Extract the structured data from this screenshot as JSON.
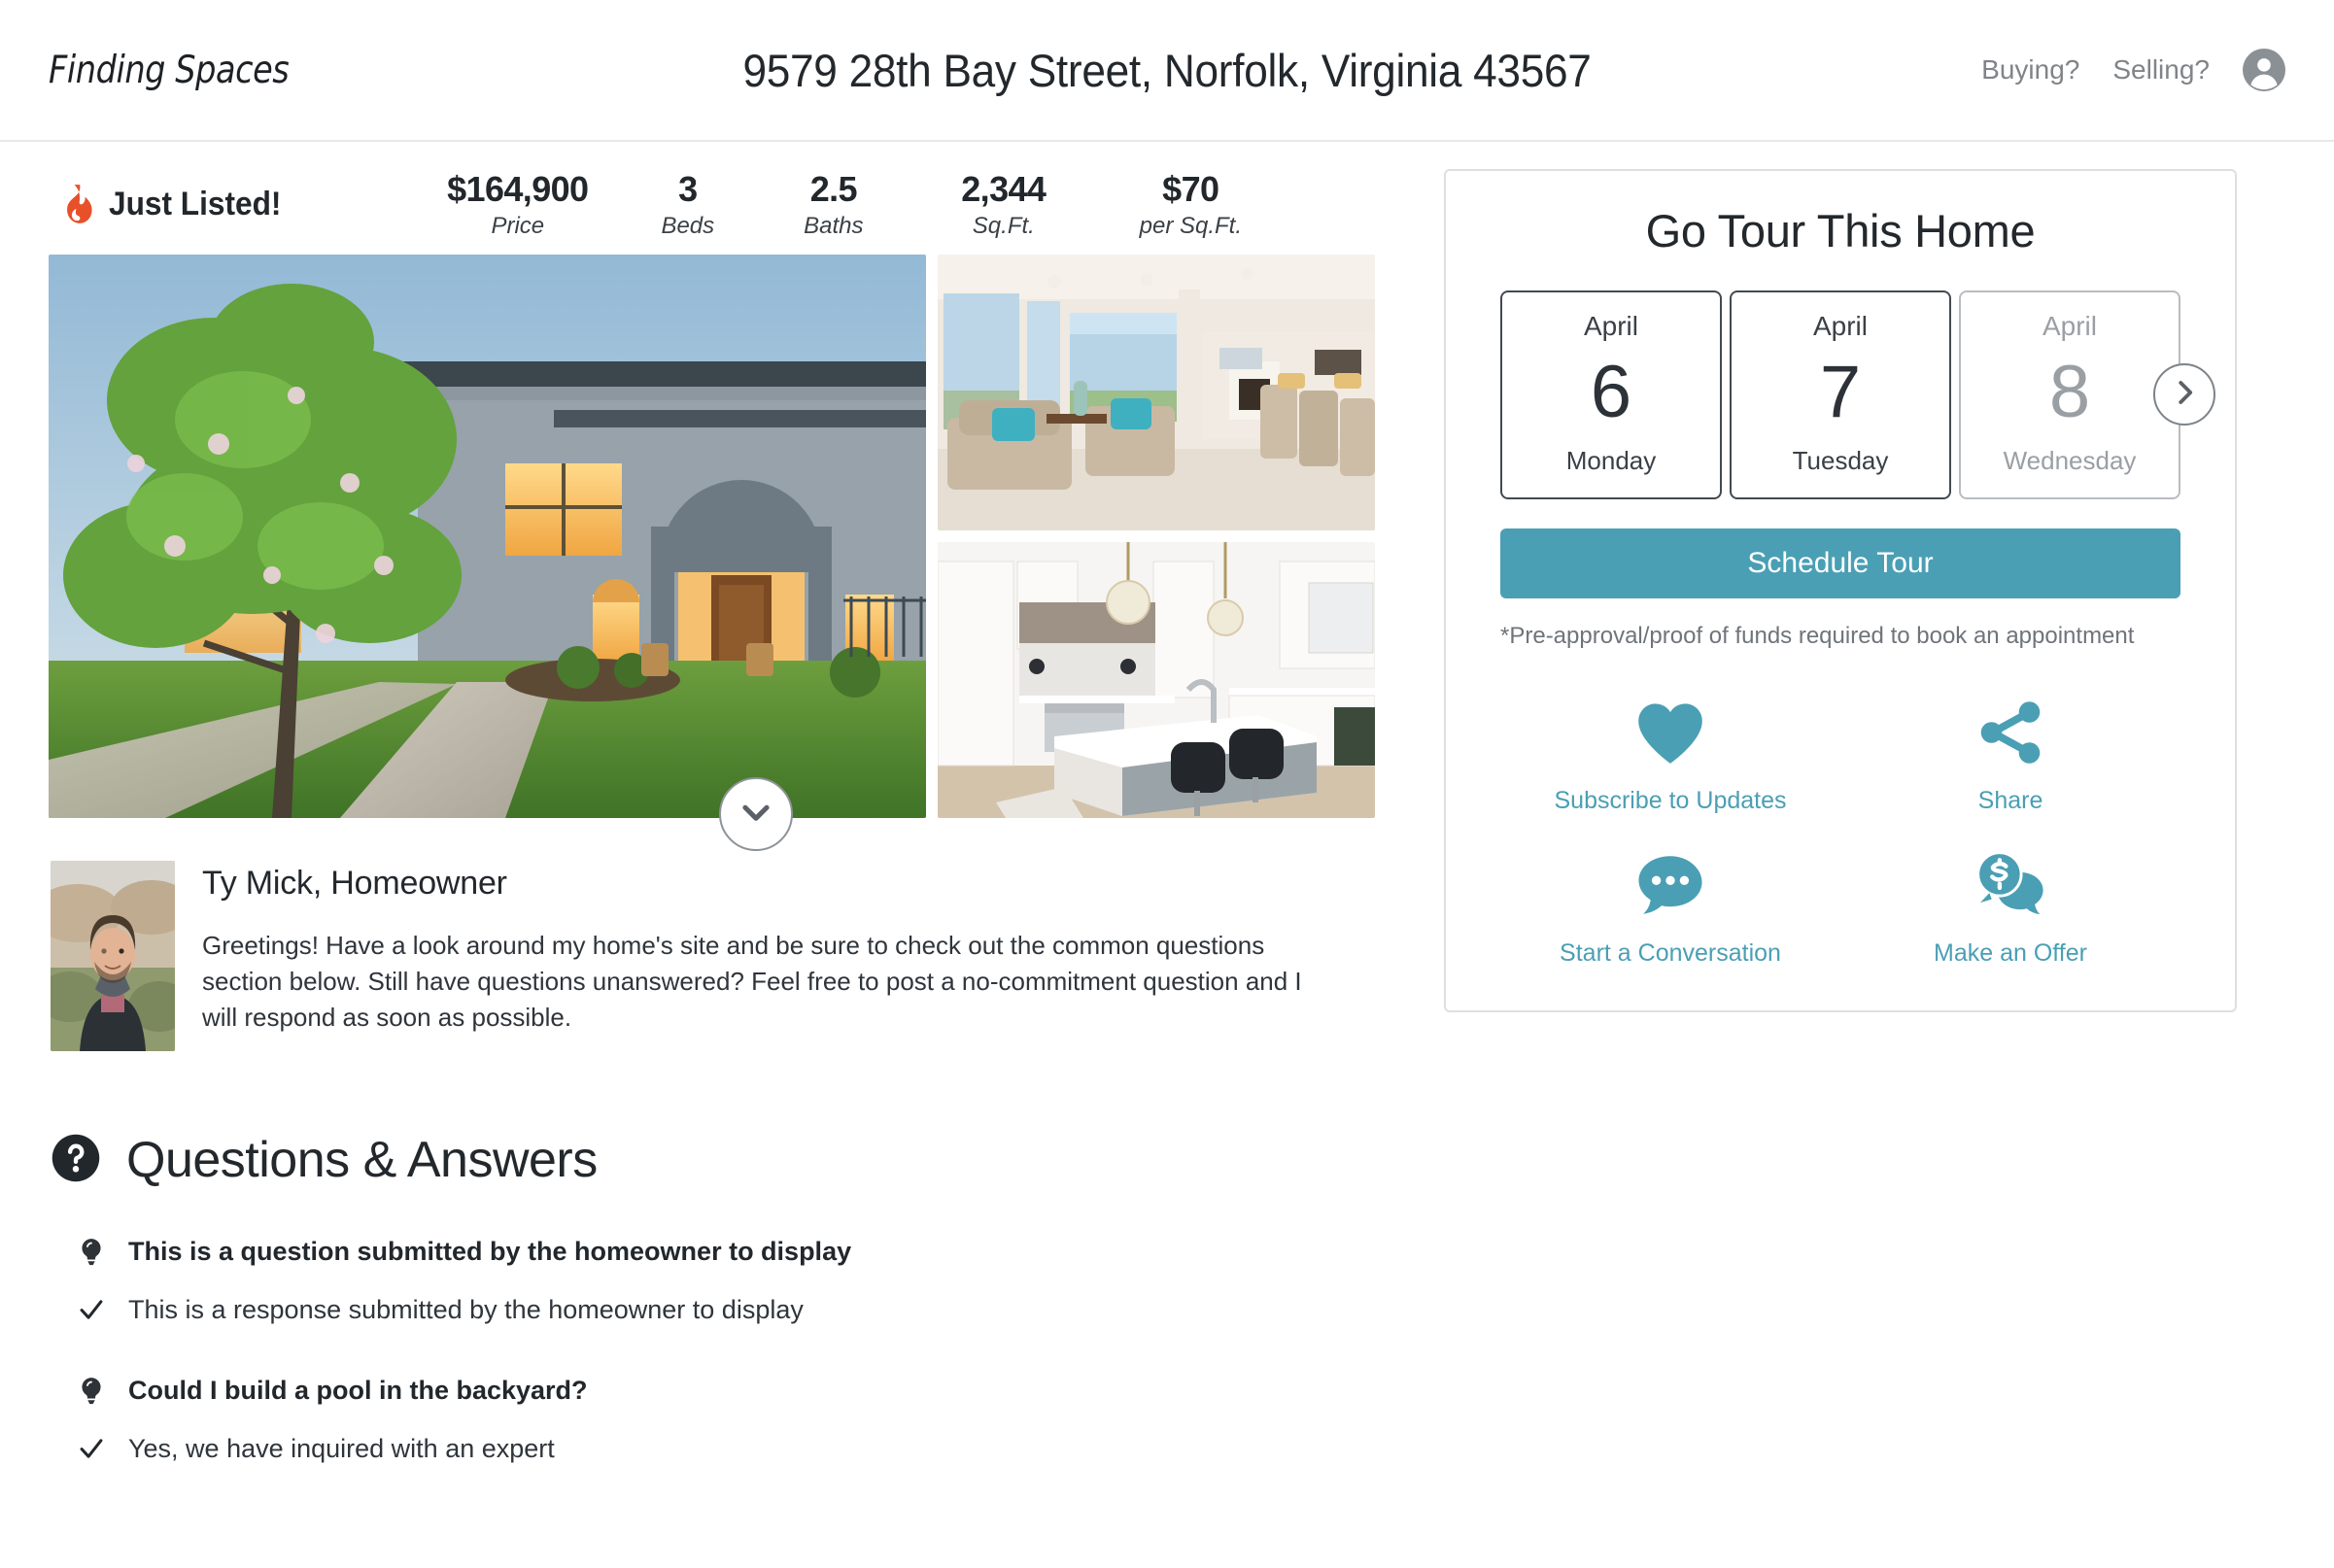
{
  "header": {
    "brand": "Finding Spaces",
    "address_title": "9579 28th Bay Street, Norfolk, Virginia 43567",
    "nav": [
      {
        "label": "Buying?"
      },
      {
        "label": "Selling?"
      }
    ],
    "avatar_icon": "user-circle-icon"
  },
  "listing": {
    "badge_icon": "flame-icon",
    "badge_label": "Just Listed!",
    "stats": [
      {
        "value": "$164,900",
        "label": "Price"
      },
      {
        "value": "3",
        "label": "Beds"
      },
      {
        "value": "2.5",
        "label": "Baths"
      },
      {
        "value": "2,344",
        "label": "Sq.Ft."
      },
      {
        "value": "$70",
        "label": "per Sq.Ft."
      }
    ]
  },
  "gallery": {
    "main_photo_alt": "Mediterranean style home exterior at dusk with lit windows and flowering tree",
    "thumb_1_alt": "Bright living room with beige armchairs and teal pillows",
    "thumb_2_alt": "White kitchen with island, crystal pendant lights and black bar stools",
    "expand_icon": "chevron-down-icon"
  },
  "owner": {
    "photo_alt": "Portrait of homeowner in dark jacket outdoors",
    "name": "Ty Mick, Homeowner",
    "message": "Greetings! Have a look around my home's site and be sure to check out the common questions section below. Still have questions unanswered? Feel free to post a no-commitment question and I will respond as soon as possible."
  },
  "qa": {
    "heading_icon": "question-circle-icon",
    "heading": "Questions & Answers",
    "items": [
      {
        "question_icon": "lightbulb-icon",
        "question": "This is a question submitted by the homeowner to display",
        "answer_icon": "check-icon",
        "answer": "This is a response submitted by the homeowner to display"
      },
      {
        "question_icon": "lightbulb-icon",
        "question": "Could I build a pool in the backyard?",
        "answer_icon": "check-icon",
        "answer": "Yes, we have inquired with an expert"
      }
    ]
  },
  "tour": {
    "title": "Go Tour This Home",
    "dates": [
      {
        "month": "April",
        "day": "6",
        "weekday": "Monday",
        "state": "available"
      },
      {
        "month": "April",
        "day": "7",
        "weekday": "Tuesday",
        "state": "available"
      },
      {
        "month": "April",
        "day": "8",
        "weekday": "Wednesday",
        "state": "muted"
      }
    ],
    "next_icon": "chevron-right-icon",
    "schedule_label": "Schedule Tour",
    "disclaimer": "*Pre-approval/proof of funds required to book an appointment",
    "actions": [
      {
        "icon": "heart-icon",
        "label": "Subscribe to Updates"
      },
      {
        "icon": "share-icon",
        "label": "Share"
      },
      {
        "icon": "chat-bubble-icon",
        "label": "Start a Conversation"
      },
      {
        "icon": "dollar-chat-icon",
        "label": "Make an Offer"
      }
    ]
  },
  "colors": {
    "accent_teal": "#4a9fb4",
    "flame_orange": "#e8502a",
    "text_dark": "#22272c",
    "text_muted": "#808488"
  }
}
